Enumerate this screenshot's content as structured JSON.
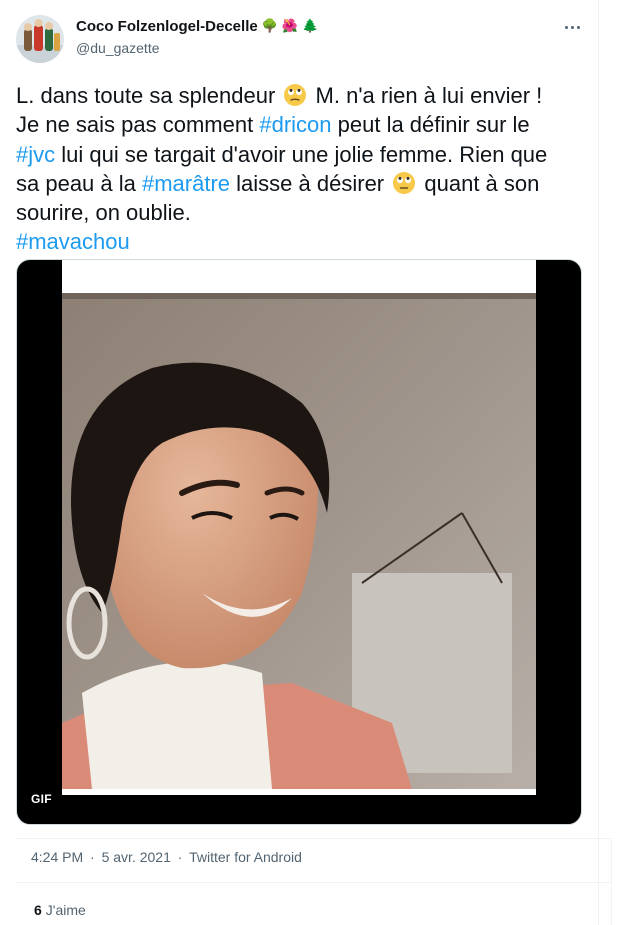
{
  "author": {
    "display_name": "Coco Folzenlogel-Decelle",
    "name_emojis": [
      "🌳",
      "🌺",
      "🌲"
    ],
    "handle": "@du_gazette",
    "avatar_icon": "avatar-icon"
  },
  "menu": {
    "more_icon": "more-icon"
  },
  "tweet": {
    "line1_a": "L. dans toute sa splendeur",
    "line1_emoji": "face-with-rolling-eyes-icon",
    "line1_b": "M. n'a rien à lui envier !",
    "line2_a": "Je ne sais pas comment",
    "tag_dricon": "#dricon",
    "line2_b": "peut la définir sur le",
    "tag_jvc": "#jvc",
    "line3_b": "lui qui se targait d'avoir une jolie femme. Rien que",
    "line4_a": "sa peau à la",
    "tag_maratre": "#marâtre",
    "line4_b": "laisse à désirer",
    "line4_emoji": "face-with-rolling-eyes-icon",
    "line4_c": "quant à son",
    "line5": "sourire, on oublie.",
    "tag_mavachou": "#mavachou"
  },
  "media": {
    "type": "gif",
    "badge": "GIF"
  },
  "meta": {
    "time": "4:24 PM",
    "separator": "·",
    "date": "5 avr. 2021",
    "source": "Twitter for Android"
  },
  "stats": {
    "likes_count": "6",
    "likes_label": "J'aime"
  },
  "colors": {
    "link": "#1d9bf0",
    "text": "#0f1419",
    "secondary": "#536471",
    "border": "#eff3f4"
  }
}
